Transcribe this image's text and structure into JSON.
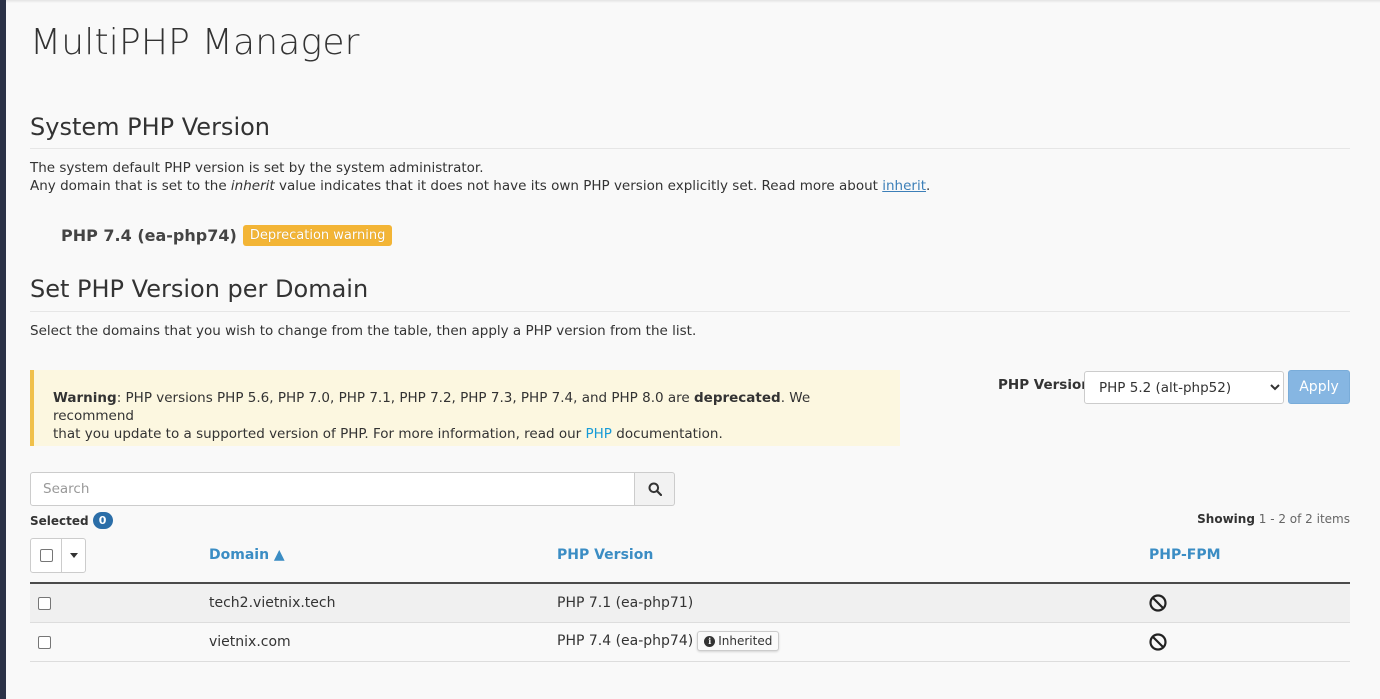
{
  "page": {
    "title": "MultiPHP Manager"
  },
  "system": {
    "heading": "System PHP Version",
    "line1": "The system default PHP version is set by the system administrator.",
    "line2_before": "Any domain that is set to the ",
    "line2_em": "inherit",
    "line2_mid": " value indicates that it does not have its own PHP version explicitly set. Read more about ",
    "line2_link": "inherit",
    "line2_end": ".",
    "version": "PHP 7.4 (ea-php74)",
    "badge": "Deprecation warning"
  },
  "perdomain": {
    "heading": "Set PHP Version per Domain",
    "intro": "Select the domains that you wish to change from the table, then apply a PHP version from the list."
  },
  "warning": {
    "label": "Warning",
    "text1": ": PHP versions PHP 5.6, PHP 7.0, PHP 7.1, PHP 7.2, PHP 7.3, PHP 7.4, and PHP 8.0 are ",
    "bold2": "deprecated",
    "text2": ". We recommend",
    "text3": "that you update to a supported version of PHP. For more information, read our ",
    "link": "PHP",
    "text4": " documentation."
  },
  "phpversion": {
    "label": "PHP Version",
    "selected": "PHP 5.2 (alt-php52)",
    "apply": "Apply"
  },
  "search": {
    "placeholder": "Search"
  },
  "selection": {
    "label": "Selected",
    "count": "0"
  },
  "showing": {
    "prefix": "Showing",
    "range": "1 - 2 of 2 items"
  },
  "table": {
    "headers": {
      "domain": "Domain ▲",
      "version": "PHP Version",
      "fpm": "PHP-FPM"
    },
    "rows": [
      {
        "domain": "tech2.vietnix.tech",
        "version": "PHP 7.1 (ea-php71)"
      },
      {
        "domain": "vietnix.com",
        "version": "PHP 7.4 (ea-php74)",
        "inherited": "Inherited"
      }
    ]
  },
  "icons": {
    "search": "search-icon",
    "caret": "caret-down-icon",
    "fpm": "disabled-icon",
    "info": "info-icon"
  },
  "colors": {
    "link": "#3b8dc4",
    "badge_warning": "#f3b536",
    "warning_bg": "#fcf7e0",
    "apply_button": "#86b6e2",
    "count_badge": "#2b6ea8"
  }
}
